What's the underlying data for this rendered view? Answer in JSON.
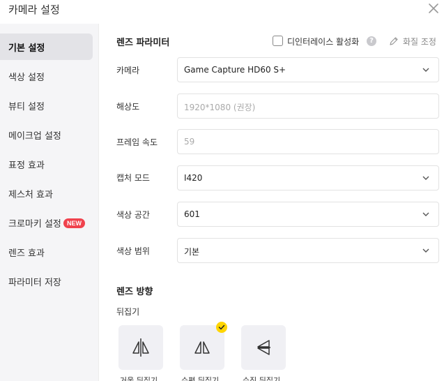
{
  "window": {
    "title": "카메라 설정",
    "close_icon": "close-icon"
  },
  "sidebar": {
    "items": [
      {
        "label": "기본 설정",
        "active": true
      },
      {
        "label": "색상 설정"
      },
      {
        "label": "뷰티 설정"
      },
      {
        "label": "메이크업 설정"
      },
      {
        "label": "표정 효과"
      },
      {
        "label": "제스처 효과"
      },
      {
        "label": "크로마키 설정",
        "badge": "NEW"
      },
      {
        "label": "렌즈 효과"
      },
      {
        "label": "파라미터 저장"
      }
    ]
  },
  "lens_params": {
    "title": "렌즈 파라미터",
    "deinterlace_label": "디인터레이스 활성화",
    "deinterlace_checked": false,
    "help_glyph": "?",
    "adjust_label": "화질 조정"
  },
  "fields": [
    {
      "label": "카메라",
      "value": "Game Capture HD60 S+",
      "type": "select"
    },
    {
      "label": "해상도",
      "value": "1920*1080 (권장)",
      "type": "disabled"
    },
    {
      "label": "프레임 속도",
      "value": "59",
      "type": "disabled"
    },
    {
      "label": "캡처 모드",
      "value": "I420",
      "type": "select"
    },
    {
      "label": "색상 공간",
      "value": "601",
      "type": "select"
    },
    {
      "label": "색상 범위",
      "value": "기본",
      "type": "select"
    }
  ],
  "lens_direction": {
    "title": "렌즈 방향",
    "flip_label": "뒤집기",
    "buttons": [
      {
        "label": "거울 뒤집기",
        "icon": "mirror-flip-icon"
      },
      {
        "label": "수평 뒤집기",
        "icon": "horizontal-flip-icon",
        "selected": true
      },
      {
        "label": "수직 뒤집기",
        "icon": "vertical-flip-icon"
      }
    ]
  },
  "colors": {
    "badge": "#f0424d",
    "check": "#ffd500",
    "active_bg": "#e3e3e7"
  }
}
